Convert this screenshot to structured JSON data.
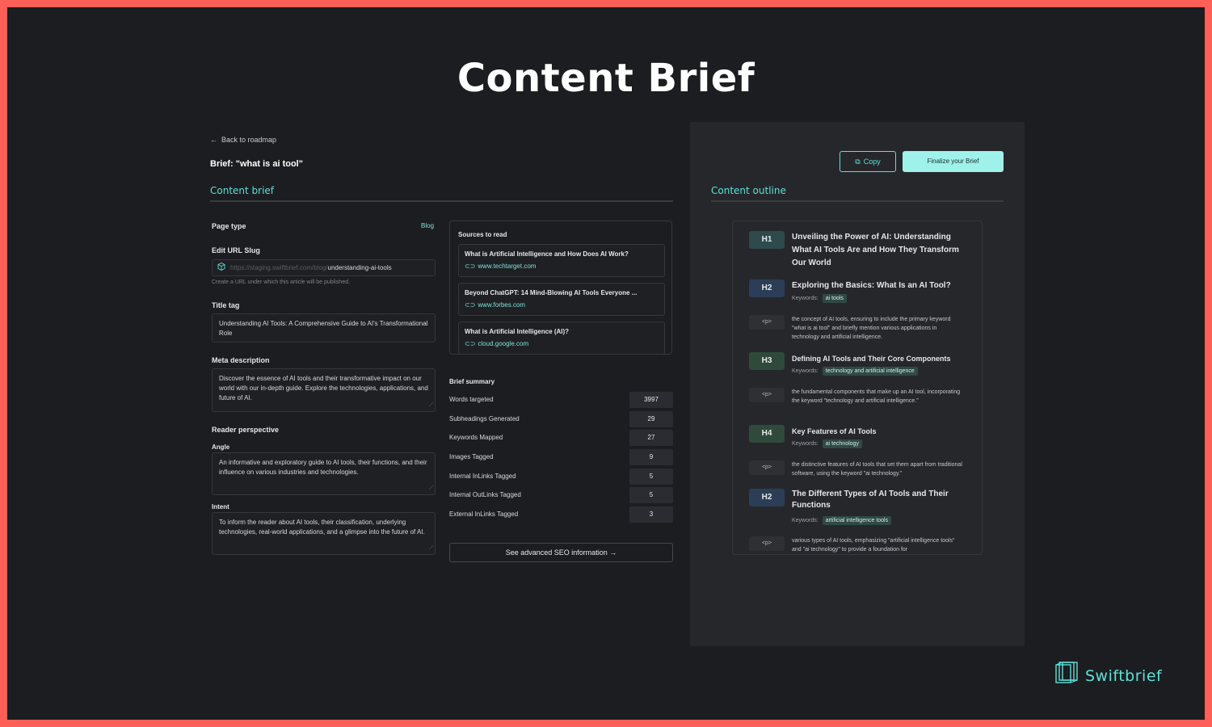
{
  "page_title": "Content Brief",
  "left": {
    "back_link": "Back to roadmap",
    "brief_title": "Brief: \"what is ai tool\"",
    "tab_label": "Content brief",
    "page_type_label": "Page type",
    "page_type_value": "Blog",
    "url_slug_label": "Edit URL Slug",
    "url_prefix": "https://staging.swiftbrief.com/blog/",
    "url_slug": "understanding-ai-tools",
    "url_hint": "Create a URL under which this article will be published.",
    "title_tag_label": "Title tag",
    "title_tag_value": "Understanding AI Tools: A Comprehensive Guide to AI's Transformational Role",
    "meta_label": "Meta description",
    "meta_value": "Discover the essence of AI tools and their transformative impact on our world with our in-depth guide. Explore the technologies, applications, and future of AI.",
    "reader_label": "Reader perspective",
    "angle_label": "Angle",
    "angle_value": "An informative and exploratory guide to AI tools, their functions, and their influence on various industries and technologies.",
    "intent_label": "Intent",
    "intent_value": "To inform the reader about AI tools, their classification, underlying technologies, real-world applications, and a glimpse into the future of AI."
  },
  "sources": {
    "title": "Sources to read",
    "items": [
      {
        "title": "What is Artificial Intelligence and How Does AI Work?",
        "url": "www.techtarget.com"
      },
      {
        "title": "Beyond ChatGPT: 14 Mind-Blowing AI Tools Everyone ...",
        "url": "www.forbes.com"
      },
      {
        "title": "What is Artificial Intelligence (AI)?",
        "url": "cloud.google.com"
      }
    ]
  },
  "summary": {
    "title": "Brief summary",
    "rows": [
      {
        "label": "Words targeted",
        "value": "3997"
      },
      {
        "label": "Subheadings Generated",
        "value": "29"
      },
      {
        "label": "Keywords Mapped",
        "value": "27"
      },
      {
        "label": "Images Tagged",
        "value": "9"
      },
      {
        "label": "Internal InLinks Tagged",
        "value": "5"
      },
      {
        "label": "Internal OutLinks Tagged",
        "value": "5"
      },
      {
        "label": "External InLinks Tagged",
        "value": "3"
      }
    ],
    "seo_button": "See advanced SEO information →"
  },
  "right": {
    "copy_label": "Copy",
    "finalize_label": "Finalize your Brief",
    "tab_label": "Content outline",
    "keywords_label": "Keywords:",
    "outline": [
      {
        "tag": "H1",
        "text": "Unveiling the Power of AI: Understanding What AI Tools Are and How They Transform Our World"
      },
      {
        "tag": "H2",
        "text": "Exploring the Basics: What Is an AI Tool?",
        "keyword": "ai tools"
      },
      {
        "tag": "<p>",
        "text": "the concept of AI tools, ensuring to include the primary keyword \"what is ai tool\" and briefly mention various applications in technology and artificial intelligence."
      },
      {
        "tag": "H3",
        "text": "Defining AI Tools and Their Core Components",
        "keyword": "technology and artificial intelligence"
      },
      {
        "tag": "<p>",
        "text": "the fundamental components that make up an AI tool, incorporating the keyword \"technology and artificial intelligence.\""
      },
      {
        "tag": "H4",
        "text": "Key Features of AI Tools",
        "keyword": "ai technology"
      },
      {
        "tag": "<p>",
        "text": "the distinctive features of AI tools that set them apart from traditional software, using the keyword \"ai technology.\""
      },
      {
        "tag": "H2",
        "text": "The Different Types of AI Tools and Their Functions",
        "keyword": "artificial intelligence tools"
      },
      {
        "tag": "<p>",
        "text": "various types of AI tools, emphasizing \"artificial intelligence tools\" and \"ai technology\" to provide a foundation for"
      }
    ]
  },
  "brand": {
    "name": "Swiftbrief"
  },
  "colors": {
    "accent": "#5ce1d8",
    "frame": "#ff5f57",
    "background": "#1c1d20",
    "panel": "#26272b"
  }
}
